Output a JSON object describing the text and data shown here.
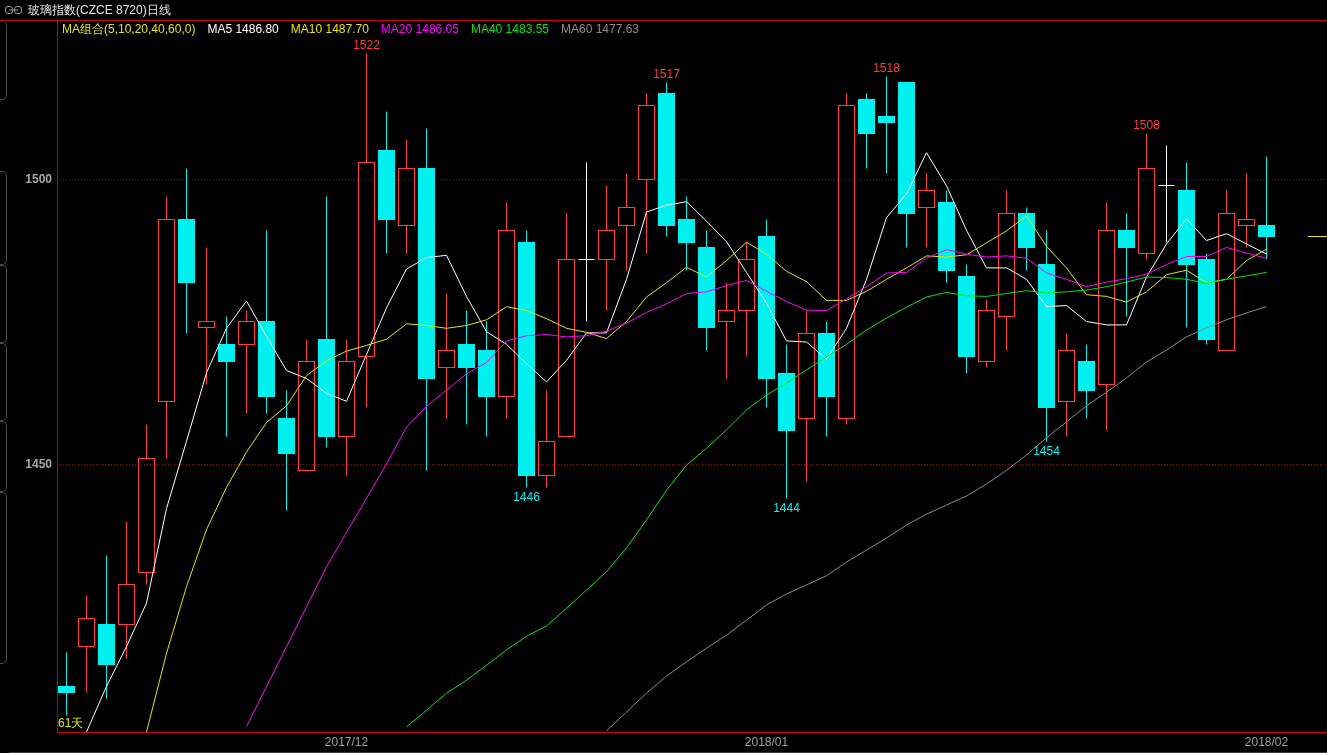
{
  "title_bar": {
    "title": "玻璃指数(CZCE 8720)日线"
  },
  "chart": {
    "legend": {
      "title": "MA组合(5,10,20,40,60,0)",
      "values": [
        "1486.80",
        "1487.70",
        "1486.05",
        "1483.55",
        "1477.63"
      ]
    },
    "day_count": "61天",
    "chart_data": {
      "type": "candlestick",
      "categories": [
        null,
        null,
        null,
        null,
        null,
        null,
        null,
        null,
        null,
        null,
        null,
        null,
        null,
        null,
        "2017/12",
        null,
        null,
        null,
        null,
        null,
        null,
        null,
        null,
        null,
        null,
        null,
        null,
        null,
        null,
        null,
        null,
        null,
        null,
        null,
        null,
        "2018/01",
        null,
        null,
        null,
        null,
        null,
        null,
        null,
        null,
        null,
        null,
        null,
        null,
        null,
        null,
        null,
        null,
        null,
        null,
        null,
        null,
        null,
        null,
        null,
        null,
        "2018/02"
      ],
      "ylim": [
        1403,
        1527.7
      ],
      "yticks": [
        1450,
        1500
      ],
      "ohlc": [
        [
          1411,
          1417,
          1406,
          1410
        ],
        [
          1418,
          1427,
          1410,
          1423
        ],
        [
          1422,
          1434,
          1409,
          1415
        ],
        [
          1422,
          1440,
          1416,
          1429
        ],
        [
          1431,
          1457,
          1429,
          1451
        ],
        [
          1461,
          1497,
          1451,
          1493
        ],
        [
          1493,
          1502,
          1473,
          1482
        ],
        [
          1474,
          1488,
          1464,
          1475
        ],
        [
          1471,
          1476,
          1455,
          1468
        ],
        [
          1471,
          1477,
          1459,
          1475
        ],
        [
          1475,
          1491,
          1459,
          1462
        ],
        [
          1458,
          1463,
          1442,
          1452
        ],
        [
          1449,
          1472,
          1449,
          1468
        ],
        [
          1472,
          1497,
          1453,
          1455
        ],
        [
          1455,
          1472,
          1448,
          1468
        ],
        [
          1469,
          1522,
          1460,
          1503
        ],
        [
          1505,
          1512,
          1487,
          1493
        ],
        [
          1492,
          1507,
          1487,
          1502
        ],
        [
          1502,
          1509,
          1449,
          1465
        ],
        [
          1467,
          1480,
          1458,
          1470
        ],
        [
          1471,
          1477,
          1457,
          1467
        ],
        [
          1470,
          1475,
          1455,
          1462
        ],
        [
          1462,
          1496,
          1458,
          1491
        ],
        [
          1489,
          1491,
          1446,
          1448
        ],
        [
          1448,
          1463,
          1446,
          1454
        ],
        [
          1455,
          1494,
          1455,
          1486
        ],
        [
          1486,
          1503,
          1475,
          1486
        ],
        [
          1486,
          1499,
          1477,
          1491
        ],
        [
          1492,
          1501,
          1484,
          1495
        ],
        [
          1500,
          1515,
          1487,
          1513
        ],
        [
          1515,
          1517,
          1490,
          1492
        ],
        [
          1493,
          1497,
          1484,
          1489
        ],
        [
          1488,
          1491,
          1470,
          1474
        ],
        [
          1475,
          1482,
          1465,
          1477
        ],
        [
          1477,
          1489,
          1469,
          1486
        ],
        [
          1490,
          1493,
          1460,
          1465
        ],
        [
          1466,
          1471,
          1444,
          1456
        ],
        [
          1458,
          1477,
          1447,
          1473
        ],
        [
          1473,
          1475,
          1455,
          1462
        ],
        [
          1458,
          1515,
          1457,
          1513
        ],
        [
          1514,
          1515,
          1502,
          1508
        ],
        [
          1511,
          1518,
          1501,
          1510
        ],
        [
          1517,
          1517,
          1488,
          1494
        ],
        [
          1495,
          1501,
          1488,
          1498
        ],
        [
          1496,
          1498,
          1482,
          1484
        ],
        [
          1483,
          1485,
          1466,
          1469
        ],
        [
          1468,
          1479,
          1467,
          1477
        ],
        [
          1476,
          1498,
          1470,
          1494
        ],
        [
          1494,
          1495,
          1484,
          1488
        ],
        [
          1485,
          1491,
          1454,
          1460
        ],
        [
          1461,
          1473,
          1455,
          1470
        ],
        [
          1468,
          1471,
          1458,
          1463
        ],
        [
          1464,
          1496,
          1456,
          1491
        ],
        [
          1491,
          1494,
          1476,
          1488
        ],
        [
          1487,
          1508,
          1486,
          1502
        ],
        [
          1499,
          1506,
          1489,
          1499
        ],
        [
          1498,
          1503,
          1474,
          1485
        ],
        [
          1486,
          1487,
          1471,
          1472
        ],
        [
          1470,
          1498,
          1470,
          1494
        ],
        [
          1492,
          1501,
          1488,
          1493
        ],
        [
          1492,
          1504,
          1486,
          1490
        ]
      ],
      "series": [
        {
          "name": "MA5",
          "type": "line",
          "color": "#ffffff",
          "values": [
            null,
            1403,
            1411,
            1418,
            1425.6,
            1442.2,
            1454,
            1466,
            1473.8,
            1478.6,
            1472.4,
            1466.4,
            1465,
            1462.4,
            1461,
            1469.2,
            1477.4,
            1484.2,
            1486.2,
            1486.6,
            1479.4,
            1473.2,
            1471,
            1467.6,
            1464.4,
            1468.2,
            1473,
            1473,
            1482.4,
            1494.2,
            1495.4,
            1496,
            1492.6,
            1489,
            1483.6,
            1478.2,
            1471.6,
            1471.4,
            1468.4,
            1473.8,
            1482.4,
            1493.2,
            1497.4,
            1504.6,
            1498.8,
            1491,
            1484.4,
            1484.4,
            1482.4,
            1477.6,
            1477.8,
            1475,
            1474.4,
            1474.4,
            1482.8,
            1488.6,
            1493,
            1489.2,
            1490.4,
            1488.6,
            1486.8
          ]
        },
        {
          "name": "MA10",
          "type": "line",
          "color": "#e6e600",
          "values": [
            null,
            null,
            null,
            null,
            1403,
            1416.8,
            1428.5,
            1438.5,
            1445.9,
            1452.1,
            1457.3,
            1460.2,
            1465.5,
            1468.1,
            1469.8,
            1470.8,
            1471.9,
            1474.6,
            1474.3,
            1473.8,
            1474.3,
            1475.3,
            1477.6,
            1476.9,
            1475.5,
            1473.8,
            1473.1,
            1472,
            1475,
            1479.3,
            1481.8,
            1484.5,
            1482.8,
            1485.7,
            1488.9,
            1486.8,
            1483.8,
            1482,
            1478.7,
            1478.7,
            1480.3,
            1482.4,
            1484.4,
            1486.5,
            1486.3,
            1486.7,
            1488.8,
            1490.9,
            1493.5,
            1488.2,
            1484.4,
            1479.7,
            1479.4,
            1478.4,
            1480.2,
            1483.2,
            1484,
            1481.8,
            1482.4,
            1485.7,
            1487.7
          ]
        },
        {
          "name": "MA20",
          "type": "line",
          "color": "#ff00ff",
          "values": [
            null,
            null,
            null,
            null,
            null,
            null,
            null,
            null,
            null,
            1404,
            1411,
            1418,
            1425,
            1432,
            1438,
            1444,
            1450,
            1456.5,
            1460.1,
            1463,
            1465.8,
            1467.8,
            1471.6,
            1472.5,
            1472.7,
            1472.3,
            1472.5,
            1473.3,
            1474.7,
            1476.6,
            1478.1,
            1479.9,
            1480.2,
            1481.3,
            1482.2,
            1480.3,
            1478.5,
            1477,
            1476.9,
            1479,
            1481.1,
            1483.5,
            1483.6,
            1486.1,
            1487.6,
            1486.8,
            1486.3,
            1486.5,
            1486.1,
            1483.5,
            1482.4,
            1481.1,
            1481.9,
            1482.5,
            1483.3,
            1485,
            1486.4,
            1486.4,
            1488,
            1487,
            1486.1
          ]
        },
        {
          "name": "MA40",
          "type": "line",
          "color": "#00e600",
          "values": [
            null,
            null,
            null,
            null,
            null,
            null,
            null,
            null,
            null,
            null,
            null,
            null,
            null,
            null,
            null,
            null,
            null,
            1403.9,
            1406.8,
            1409.8,
            1412.1,
            1414.7,
            1417.4,
            1419.8,
            1421.6,
            1424.7,
            1427.9,
            1431.1,
            1435.3,
            1440.2,
            1445.4,
            1449.8,
            1452.8,
            1456,
            1459.5,
            1462.1,
            1464.2,
            1466.5,
            1468.8,
            1471,
            1473.5,
            1475.6,
            1477.5,
            1479.3,
            1480.1,
            1479.5,
            1479.4,
            1479.9,
            1480.4,
            1480,
            1480.2,
            1480.5,
            1481.1,
            1481.9,
            1482.8,
            1482.7,
            1482.4,
            1481.7,
            1482.4,
            1483,
            1483.6
          ]
        },
        {
          "name": "MA60",
          "type": "line",
          "color": "#8c8c8c",
          "values": [
            null,
            null,
            null,
            null,
            null,
            null,
            null,
            null,
            null,
            null,
            null,
            null,
            null,
            null,
            null,
            null,
            null,
            null,
            null,
            null,
            null,
            null,
            null,
            null,
            null,
            null,
            null,
            1403.2,
            1406.5,
            1409.8,
            1412.8,
            1415.3,
            1417.7,
            1420,
            1422.6,
            1425.3,
            1427.2,
            1428.8,
            1430.4,
            1432.8,
            1434.9,
            1437,
            1439.3,
            1441.2,
            1442.8,
            1444.4,
            1446.5,
            1448.9,
            1451.6,
            1454.6,
            1457.4,
            1460.2,
            1462.6,
            1465.1,
            1467.9,
            1470,
            1472.3,
            1473.9,
            1475.3,
            1476.5,
            1477.6
          ]
        }
      ],
      "annotations": [
        "1522",
        "1446",
        "1517",
        "1444",
        "1518",
        "1454",
        "1508"
      ]
    }
  }
}
